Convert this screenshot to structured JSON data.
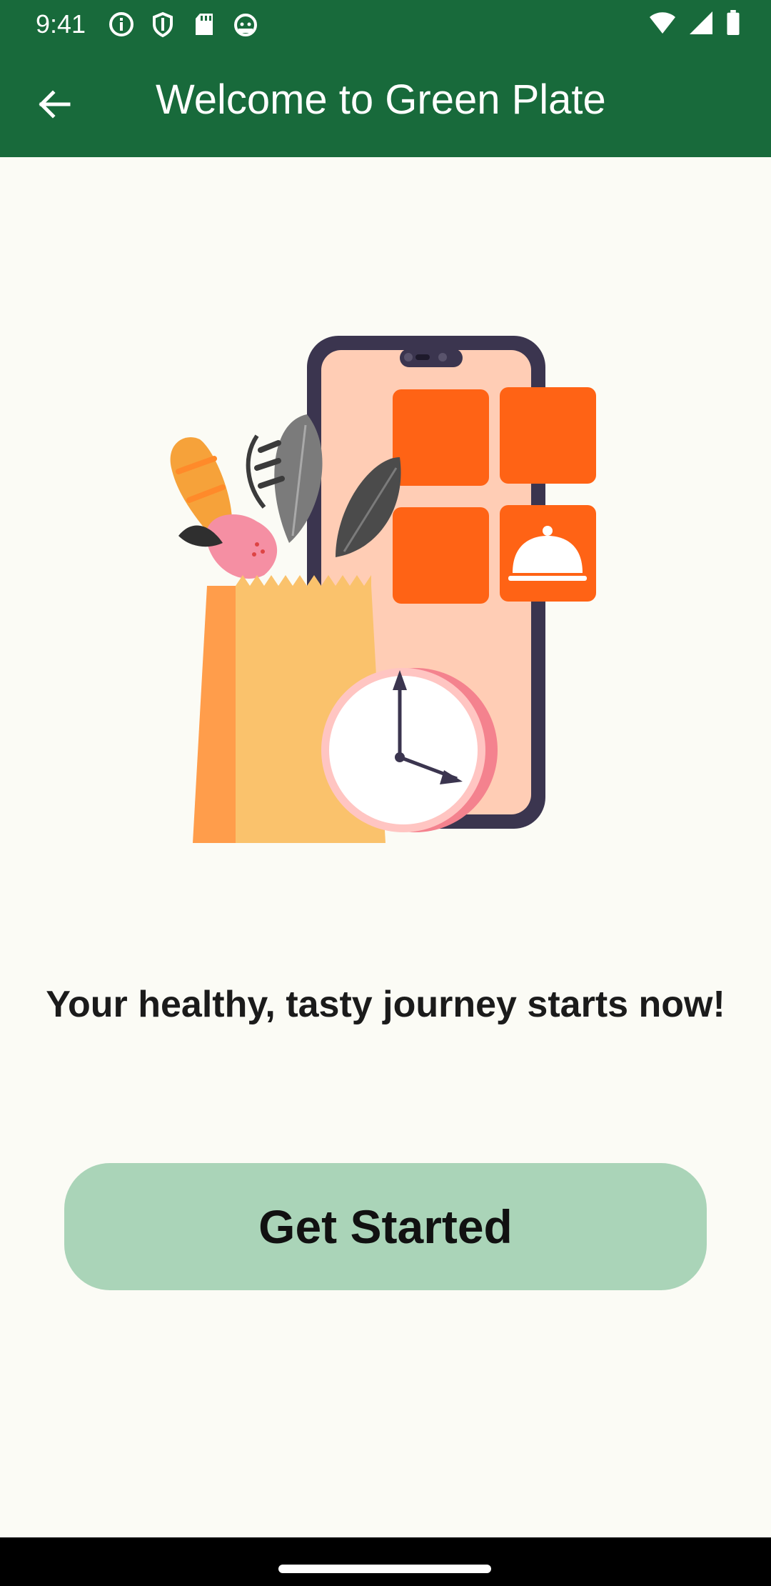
{
  "status_bar": {
    "time": "9:41",
    "left_icons": [
      "info-icon",
      "shield-icon",
      "sd-card-icon",
      "android-icon"
    ],
    "right_icons": [
      "wifi-icon",
      "signal-icon",
      "battery-icon"
    ]
  },
  "app_bar": {
    "back_icon": "arrow-left-icon",
    "title": "Welcome to Green Plate"
  },
  "illustration": {
    "description_icons": [
      "phone-icon",
      "grocery-bag-icon",
      "clock-icon",
      "cloche-icon"
    ]
  },
  "main": {
    "tagline": "Your healthy, tasty journey starts now!",
    "cta_label": "Get Started"
  },
  "colors": {
    "primary": "#186A3B",
    "background": "#FBFBF5",
    "button": "#AAD4B8",
    "accent_orange": "#FF6315"
  }
}
